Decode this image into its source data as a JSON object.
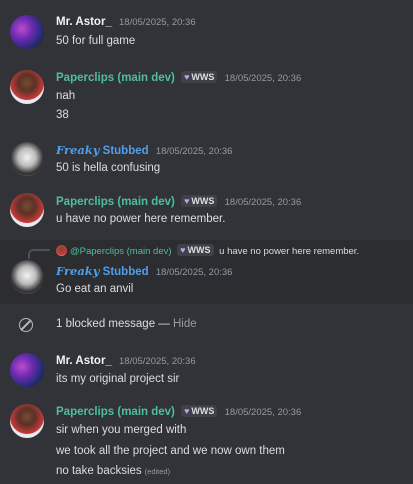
{
  "messages": [
    {
      "author": "Mr. Astor_",
      "timestamp": "18/05/2025, 20:36",
      "lines": [
        "50 for full game"
      ]
    },
    {
      "author": "Paperclips (main dev)",
      "tag": "WWS",
      "timestamp": "18/05/2025, 20:36",
      "lines": [
        "nah",
        "38"
      ]
    },
    {
      "author_fancy": "Freaky",
      "author": "Stubbed",
      "timestamp": "18/05/2025, 20:36",
      "lines": [
        "50 is hella confusing"
      ]
    },
    {
      "author": "Paperclips (main dev)",
      "tag": "WWS",
      "timestamp": "18/05/2025, 20:36",
      "lines": [
        "u have no power here remember."
      ]
    },
    {
      "reply": {
        "author": "@Paperclips (main dev)",
        "tag": "WWS",
        "text": "u have no power here remember."
      },
      "author_fancy": "Freaky",
      "author": "Stubbed",
      "timestamp": "18/05/2025, 20:36",
      "lines": [
        "Go eat an anvil"
      ]
    },
    {
      "author": "Mr. Astor_",
      "timestamp": "18/05/2025, 20:36",
      "lines": [
        "its my original project sir"
      ]
    },
    {
      "author": "Paperclips (main dev)",
      "tag": "WWS",
      "timestamp": "18/05/2025, 20:36",
      "lines": [
        "sir when you merged with",
        "we took all the project and we now own them",
        "no take backsies"
      ],
      "edited": "(edited)"
    }
  ],
  "blocked": {
    "text": "1 blocked message — ",
    "hide": "Hide"
  },
  "icons": {
    "heart": "♥",
    "blocked": "blocked-icon"
  }
}
